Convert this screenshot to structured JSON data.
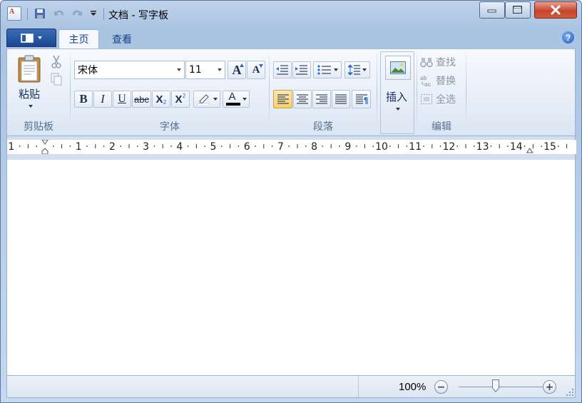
{
  "window": {
    "title": "文档 - 写字板"
  },
  "tabs": {
    "home": "主页",
    "view": "查看"
  },
  "help_label": "?",
  "clipboard": {
    "paste_label": "粘贴",
    "group_label": "剪贴板"
  },
  "font": {
    "font_name": "宋体",
    "font_size": "11",
    "bold": "B",
    "italic": "I",
    "underline": "U",
    "strikethrough": "abc",
    "subscript": "X",
    "subscript_mark": "2",
    "superscript": "X",
    "superscript_mark": "2",
    "grow": "A",
    "shrink": "A",
    "color_letter": "A",
    "group_label": "字体"
  },
  "paragraph": {
    "group_label": "段落"
  },
  "insert": {
    "label": "插入"
  },
  "editing": {
    "find": "查找",
    "replace": "替换",
    "select_all": "全选",
    "group_label": "编辑"
  },
  "ruler": {
    "numbers": [
      "1",
      "1",
      "2",
      "3",
      "4",
      "5",
      "6",
      "7",
      "8",
      "9",
      "10",
      "11",
      "12",
      "13",
      "14",
      "15"
    ]
  },
  "status": {
    "zoom": "100%",
    "zoom_out": "−",
    "zoom_in": "+"
  },
  "colors": {
    "accent": "#1b4791",
    "active_align": "#fcd67a",
    "font_color": "#000000"
  }
}
